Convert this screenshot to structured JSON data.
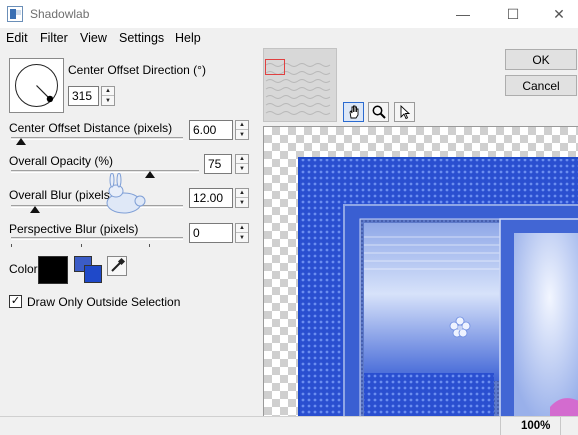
{
  "window": {
    "title": "Shadowlab",
    "minimize_glyph": "—",
    "maximize_glyph": "☐",
    "close_glyph": "✕"
  },
  "menu": [
    "Edit",
    "Filter",
    "View",
    "Settings",
    "Help"
  ],
  "controls": {
    "direction": {
      "label": "Center Offset Direction (°)",
      "value": "315",
      "angle_deg": 315
    },
    "distance": {
      "label": "Center Offset Distance (pixels)",
      "value": "6.00",
      "fraction": 0.03
    },
    "opacity": {
      "label": "Overall Opacity (%)",
      "value": "75",
      "fraction": 0.75
    },
    "blur": {
      "label": "Overall Blur (pixels)",
      "value": "12.00",
      "fraction": 0.12
    },
    "perspective": {
      "label": "Perspective Blur (pixels)",
      "value": "0",
      "fraction": 0.0
    },
    "color": {
      "label": "Color",
      "shadow_color": "#000000",
      "swap_color_a": "#3b5cc7",
      "swap_color_b": "#1f49c9"
    },
    "outside_selection": {
      "label": "Draw Only Outside Selection",
      "checked": true,
      "mark": "✓"
    }
  },
  "buttons": {
    "ok": "OK",
    "cancel": "Cancel"
  },
  "tools": [
    "hand-icon",
    "zoom-icon",
    "pointer-icon"
  ],
  "status": {
    "zoom": "100%"
  },
  "colors": {
    "selection_box": "#e04040",
    "preview_blue": "#1f49c9",
    "active_tool_border": "#2a6ad0"
  }
}
